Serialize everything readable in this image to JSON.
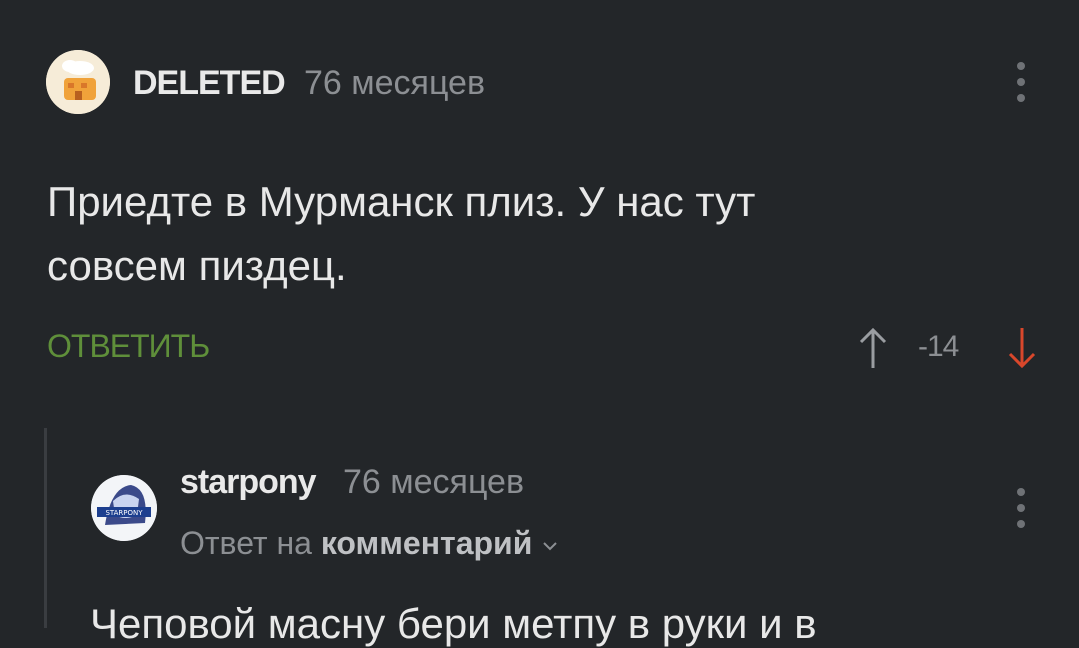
{
  "comment": {
    "author": "DELETED",
    "time": "76 месяцев",
    "text_line1": "Приедте в Мурманск плиз. У нас тут",
    "text_line2": "совсем пиздец.",
    "reply_label": "ОТВЕТИТЬ",
    "score": "-14",
    "colors": {
      "reply": "#5f8f3a",
      "downvote": "#d9472b",
      "upvote": "#9a9da1"
    }
  },
  "reply": {
    "author": "starpony",
    "time": "76 месяцев",
    "reply_to_prefix": "Ответ на",
    "reply_to_link": "комментарий",
    "avatar_text": "STARPONY",
    "partial_text": "Чеповой масну бери метпу в руки и в"
  }
}
